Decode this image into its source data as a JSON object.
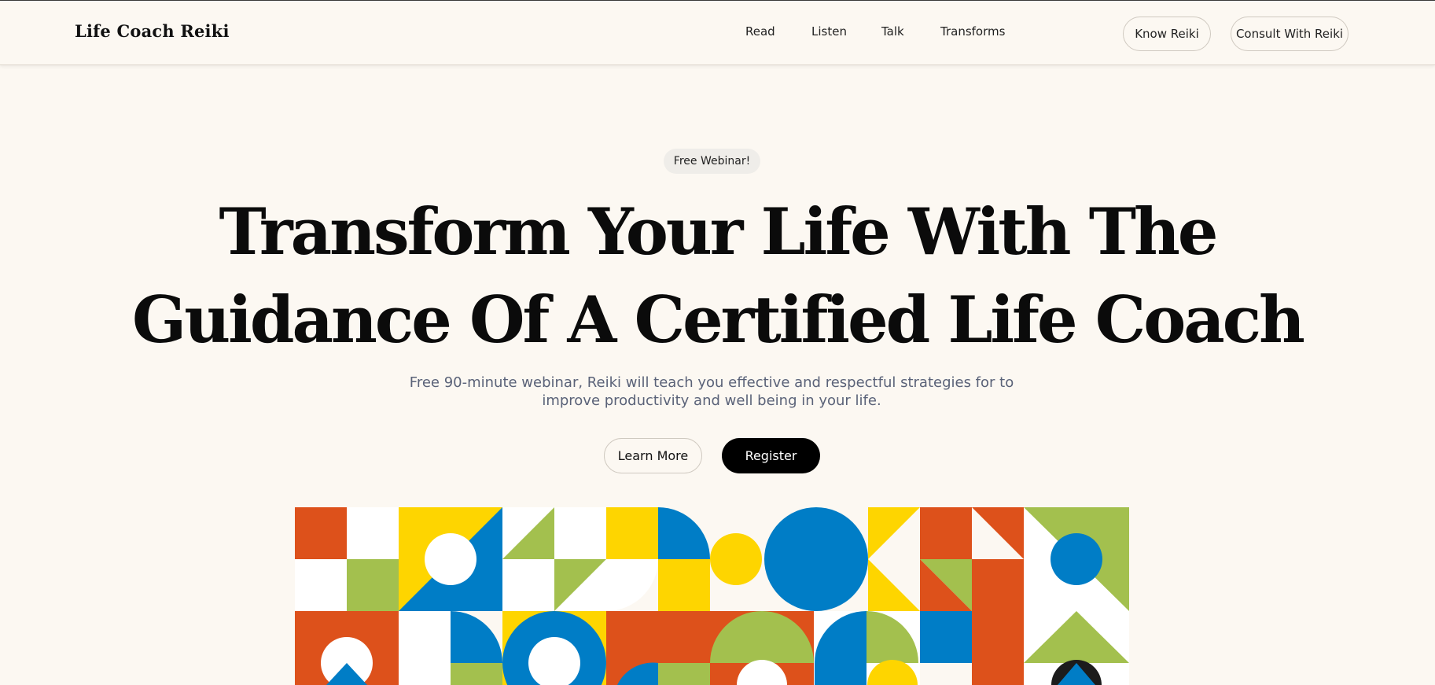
{
  "header": {
    "logo": "Life Coach Reiki",
    "nav": [
      "Read",
      "Listen",
      "Talk",
      "Transforms"
    ],
    "know_button": "Know Reiki",
    "consult_button": "Consult With Reiki"
  },
  "hero": {
    "badge": "Free Webinar!",
    "headline_line1": "Transform Your Life With The",
    "headline_line2": "Guidance Of A Certified Life Coach",
    "subtitle": "Free 90-minute webinar, Reiki will teach you effective and respectful strategies for to improve productivity and well being in your life.",
    "learn_more": "Learn More",
    "register": "Register"
  },
  "mosaic": {
    "colors": {
      "orange": "#dd511b",
      "yellow": "#fed500",
      "blue": "#007dc6",
      "green": "#a3c04e",
      "white": "#ffffff",
      "black": "#1c1c1c"
    }
  }
}
